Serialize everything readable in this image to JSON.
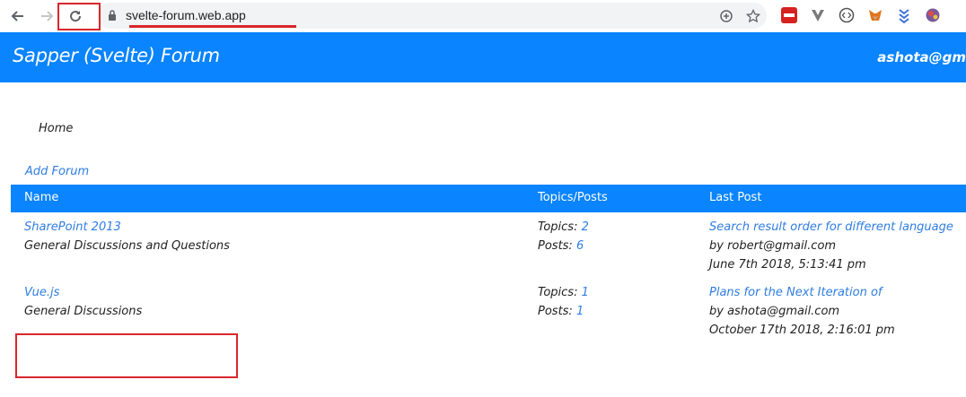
{
  "browser": {
    "url": "svelte-forum.web.app"
  },
  "app": {
    "brand": "Sapper (Svelte)  Forum",
    "user": "ashota@gm"
  },
  "breadcrumb": "Home",
  "add_forum": "Add Forum",
  "table": {
    "headers": [
      "Name",
      "Topics/Posts",
      "Last Post"
    ],
    "rows": [
      {
        "name": "SharePoint 2013",
        "description": "General Discussions and Questions",
        "topics_label": "Topics:",
        "topics": "2",
        "posts_label": "Posts:",
        "posts": "6",
        "last_title": "Search result order for different language",
        "last_by": "by robert@gmail.com",
        "last_date": "June 7th 2018, 5:13:41 pm"
      },
      {
        "name": "Vue.js",
        "description": "General Discussions",
        "topics_label": "Topics:",
        "topics": "1",
        "posts_label": "Posts:",
        "posts": "1",
        "last_title": "Plans for the Next Iteration of",
        "last_by": "by ashota@gmail.com",
        "last_date": "October 17th 2018, 2:16:01 pm"
      }
    ]
  },
  "colors": {
    "brand_blue": "#0a84ff",
    "link": "#2f7de1",
    "annotation": "#d9262c"
  }
}
